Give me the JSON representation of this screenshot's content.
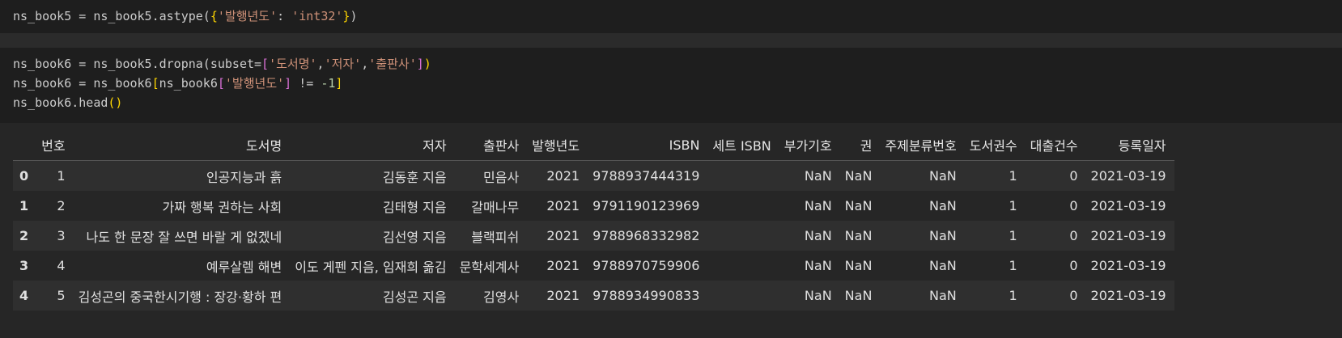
{
  "cells": {
    "cell1": {
      "line1": {
        "a": "ns_book5 = ns_book5.astype(",
        "b": "{",
        "c": "'발행년도'",
        "d": ": ",
        "e": "'int32'",
        "f": "}",
        "g": ")"
      }
    },
    "cell2": {
      "line1": {
        "a": "ns_book6 = ns_book5.dropna(subset=",
        "b": "[",
        "c": "'도서명'",
        "d": ",",
        "e": "'저자'",
        "f": ",",
        "g": "'출판사'",
        "h": "]",
        "i": ")"
      },
      "line2": {
        "a": "ns_book6 = ns_book6",
        "b": "[",
        "c": "ns_book6",
        "d": "[",
        "e": "'발행년도'",
        "f": "]",
        "g": " != ",
        "h": "-1",
        "i": "]"
      },
      "line3": {
        "a": "ns_book6.head",
        "b": "()"
      }
    }
  },
  "table": {
    "columns": [
      "",
      "번호",
      "도서명",
      "저자",
      "출판사",
      "발행년도",
      "ISBN",
      "세트 ISBN",
      "부가기호",
      "권",
      "주제분류번호",
      "도서권수",
      "대출건수",
      "등록일자"
    ],
    "rows": [
      [
        "0",
        "1",
        "인공지능과 흙",
        "김동훈 지음",
        "민음사",
        "2021",
        "9788937444319",
        "",
        "NaN",
        "NaN",
        "NaN",
        "1",
        "0",
        "2021-03-19"
      ],
      [
        "1",
        "2",
        "가짜 행복 권하는 사회",
        "김태형 지음",
        "갈매나무",
        "2021",
        "9791190123969",
        "",
        "NaN",
        "NaN",
        "NaN",
        "1",
        "0",
        "2021-03-19"
      ],
      [
        "2",
        "3",
        "나도 한 문장 잘 쓰면 바랄 게 없겠네",
        "김선영 지음",
        "블랙피쉬",
        "2021",
        "9788968332982",
        "",
        "NaN",
        "NaN",
        "NaN",
        "1",
        "0",
        "2021-03-19"
      ],
      [
        "3",
        "4",
        "예루살렘 해변",
        "이도 게펜 지음, 임재희 옮김",
        "문학세계사",
        "2021",
        "9788970759906",
        "",
        "NaN",
        "NaN",
        "NaN",
        "1",
        "0",
        "2021-03-19"
      ],
      [
        "4",
        "5",
        "김성곤의 중국한시기행 : 장강·황하 편",
        "김성곤 지음",
        "김영사",
        "2021",
        "9788934990833",
        "",
        "NaN",
        "NaN",
        "NaN",
        "1",
        "0",
        "2021-03-19"
      ]
    ]
  }
}
